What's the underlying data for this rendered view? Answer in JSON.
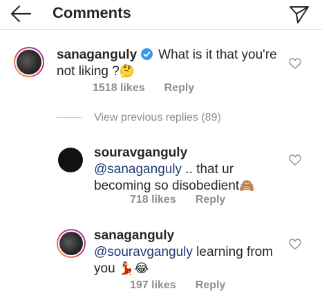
{
  "header": {
    "title": "Comments",
    "back_icon": "arrow-left-icon",
    "send_icon": "paper-plane-icon"
  },
  "comments": [
    {
      "username": "sanaganguly",
      "verified": true,
      "text_line1": "What is it that you're",
      "text_line2": "not liking ?",
      "emoji": "🤔",
      "likes": "1518 likes",
      "reply": "Reply"
    }
  ],
  "view_replies": "View previous replies (89)",
  "replies": [
    {
      "username": "souravganguly",
      "mention": "@sanaganguly",
      "text_line1": " .. that ur",
      "text_line2": "becoming so disobedient",
      "emoji": "🙈",
      "likes": "718 likes",
      "reply": "Reply"
    },
    {
      "username": "sanaganguly",
      "mention": "@souravganguly",
      "text_line1": " learning from",
      "text_line2": "you ",
      "emoji": "💃😂",
      "likes": "197 likes",
      "reply": "Reply"
    }
  ],
  "colors": {
    "text": "#262626",
    "muted": "#8e8e8e",
    "mention": "#1f3a74",
    "verified": "#3897f0",
    "divider": "#dbdbdb"
  }
}
